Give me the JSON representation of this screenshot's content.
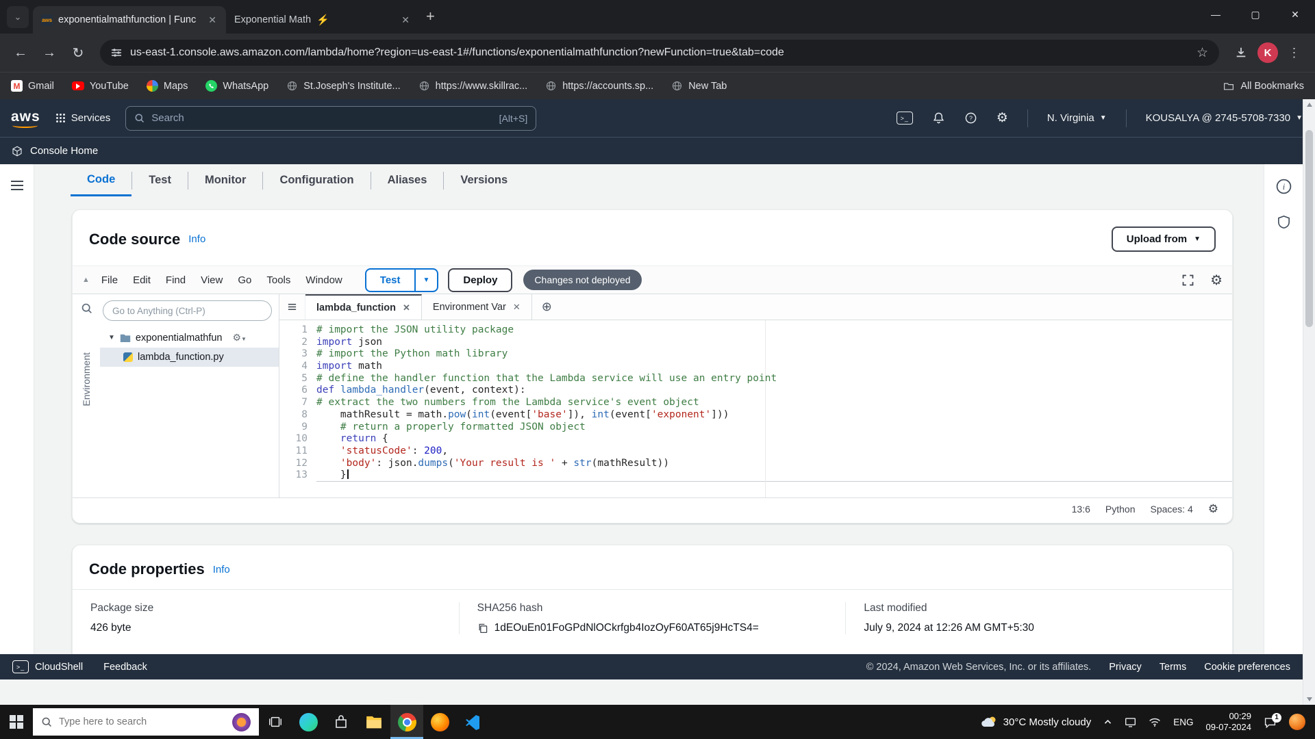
{
  "browser": {
    "tabs": [
      {
        "title": "exponentialmathfunction | Func",
        "icon": "aws-favicon"
      },
      {
        "title": "Exponential Math",
        "icon": "lightning-icon"
      }
    ],
    "url": "us-east-1.console.aws.amazon.com/lambda/home?region=us-east-1#/functions/exponentialmathfunction?newFunction=true&tab=code",
    "bookmarks": [
      {
        "label": "Gmail",
        "icon": "gmail-favicon"
      },
      {
        "label": "YouTube",
        "icon": "youtube-favicon"
      },
      {
        "label": "Maps",
        "icon": "maps-favicon"
      },
      {
        "label": "WhatsApp",
        "icon": "whatsapp-favicon"
      },
      {
        "label": "St.Joseph's Institute...",
        "icon": "globe-favicon"
      },
      {
        "label": "https://www.skillrac...",
        "icon": "globe-favicon"
      },
      {
        "label": "https://accounts.sp...",
        "icon": "globe-favicon"
      },
      {
        "label": "New Tab",
        "icon": "globe-favicon"
      }
    ],
    "all_bookmarks": "All Bookmarks",
    "avatar_letter": "K"
  },
  "aws": {
    "services": "Services",
    "search_placeholder": "Search",
    "search_shortcut": "[Alt+S]",
    "region": "N. Virginia",
    "account": "KOUSALYA @ 2745-5708-7330",
    "console_home": "Console Home",
    "tabs": [
      "Code",
      "Test",
      "Monitor",
      "Configuration",
      "Aliases",
      "Versions"
    ]
  },
  "code_source": {
    "title": "Code source",
    "info": "Info",
    "upload": "Upload from",
    "menus": [
      "File",
      "Edit",
      "Find",
      "View",
      "Go",
      "Tools",
      "Window"
    ],
    "test": "Test",
    "deploy": "Deploy",
    "changes": "Changes not deployed",
    "goto_placeholder": "Go to Anything (Ctrl-P)",
    "env_label": "Environment",
    "folder": "exponentialmathfun",
    "file": "lambda_function.py",
    "editor_tabs": [
      "lambda_function",
      "Environment Var"
    ],
    "status": {
      "pos": "13:6",
      "lang": "Python",
      "spaces": "Spaces: 4"
    },
    "lines": [
      {
        "n": 1,
        "tokens": [
          {
            "t": "c",
            "s": "# import the JSON utility package"
          }
        ]
      },
      {
        "n": 2,
        "tokens": [
          {
            "t": "k",
            "s": "import"
          },
          {
            "t": "p",
            "s": " json"
          }
        ]
      },
      {
        "n": 3,
        "tokens": [
          {
            "t": "c",
            "s": "# import the Python math library"
          }
        ]
      },
      {
        "n": 4,
        "tokens": [
          {
            "t": "k",
            "s": "import"
          },
          {
            "t": "p",
            "s": " math"
          }
        ]
      },
      {
        "n": 5,
        "tokens": [
          {
            "t": "c",
            "s": "# define the handler function that the Lambda service will use an entry point"
          }
        ]
      },
      {
        "n": 6,
        "tokens": [
          {
            "t": "k",
            "s": "def"
          },
          {
            "t": "p",
            "s": " "
          },
          {
            "t": "f",
            "s": "lambda_handler"
          },
          {
            "t": "p",
            "s": "(event, context):"
          }
        ]
      },
      {
        "n": 7,
        "tokens": [
          {
            "t": "c",
            "s": "# extract the two numbers from the Lambda service's event object"
          }
        ]
      },
      {
        "n": 8,
        "tokens": [
          {
            "t": "p",
            "s": "    mathResult = math."
          },
          {
            "t": "f",
            "s": "pow"
          },
          {
            "t": "p",
            "s": "("
          },
          {
            "t": "f",
            "s": "int"
          },
          {
            "t": "p",
            "s": "(event["
          },
          {
            "t": "s",
            "s": "'base'"
          },
          {
            "t": "p",
            "s": "]), "
          },
          {
            "t": "f",
            "s": "int"
          },
          {
            "t": "p",
            "s": "(event["
          },
          {
            "t": "s",
            "s": "'exponent'"
          },
          {
            "t": "p",
            "s": "]))"
          }
        ]
      },
      {
        "n": 9,
        "tokens": [
          {
            "t": "c",
            "s": "    # return a properly formatted JSON object"
          }
        ]
      },
      {
        "n": 10,
        "tokens": [
          {
            "t": "p",
            "s": "    "
          },
          {
            "t": "k",
            "s": "return"
          },
          {
            "t": "p",
            "s": " {"
          }
        ]
      },
      {
        "n": 11,
        "tokens": [
          {
            "t": "p",
            "s": "    "
          },
          {
            "t": "s",
            "s": "'statusCode'"
          },
          {
            "t": "p",
            "s": ": "
          },
          {
            "t": "n",
            "s": "200"
          },
          {
            "t": "p",
            "s": ","
          }
        ]
      },
      {
        "n": 12,
        "tokens": [
          {
            "t": "p",
            "s": "    "
          },
          {
            "t": "s",
            "s": "'body'"
          },
          {
            "t": "p",
            "s": ": json."
          },
          {
            "t": "f",
            "s": "dumps"
          },
          {
            "t": "p",
            "s": "("
          },
          {
            "t": "s",
            "s": "'Your result is '"
          },
          {
            "t": "p",
            "s": " + "
          },
          {
            "t": "f",
            "s": "str"
          },
          {
            "t": "p",
            "s": "(mathResult))"
          }
        ]
      },
      {
        "n": 13,
        "active": true,
        "cursor": true,
        "tokens": [
          {
            "t": "p",
            "s": "    }"
          }
        ]
      }
    ]
  },
  "code_properties": {
    "title": "Code properties",
    "info": "Info",
    "cols": [
      {
        "label": "Package size",
        "value": "426 byte"
      },
      {
        "label": "SHA256 hash",
        "value": "1dEOuEn01FoGPdNlOCkrfgb4IozOyF60AT65j9HcTS4="
      },
      {
        "label": "Last modified",
        "value": "July 9, 2024 at 12:26 AM GMT+5:30"
      }
    ]
  },
  "footer": {
    "cloudshell": "CloudShell",
    "feedback": "Feedback",
    "copyright": "© 2024, Amazon Web Services, Inc. or its affiliates.",
    "privacy": "Privacy",
    "terms": "Terms",
    "cookies": "Cookie preferences"
  },
  "taskbar": {
    "search_placeholder": "Type here to search",
    "weather": "30°C Mostly cloudy",
    "lang": "ENG",
    "time": "00:29",
    "date": "09-07-2024",
    "badge": "1"
  },
  "colors": {
    "aws_header": "#232f3e",
    "aws_orange": "#ff9900",
    "link_blue": "#0972d3",
    "badge_gray": "#555f6d"
  }
}
